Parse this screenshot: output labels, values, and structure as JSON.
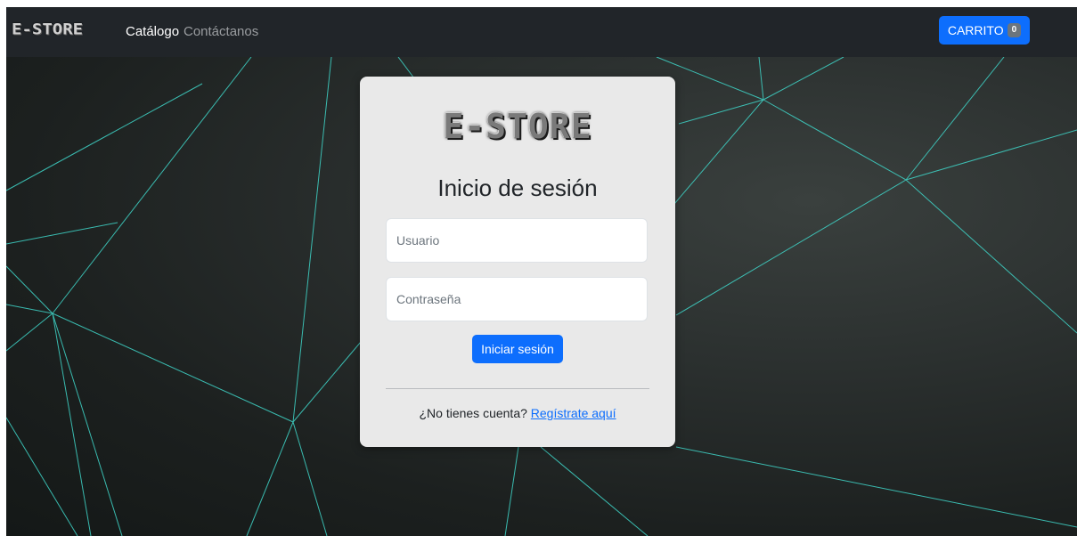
{
  "navbar": {
    "brand": "E-STORE",
    "links": [
      {
        "label": "Catálogo"
      },
      {
        "label": "Contáctanos"
      }
    ],
    "cart": {
      "label": "CARRITO",
      "count": "0"
    }
  },
  "login": {
    "logo": "E-STORE",
    "title": "Inicio de sesión",
    "username_placeholder": "Usuario",
    "password_placeholder": "Contraseña",
    "submit_label": "Iniciar sesión",
    "register_prompt": "¿No tienes cuenta?",
    "register_link": "Regístrate aquí"
  },
  "colors": {
    "navbar": "#212529",
    "primary": "#0d6efd",
    "badge": "#6c757d",
    "card": "#e9e9e9",
    "accent_lines": "#3fd6c9"
  }
}
